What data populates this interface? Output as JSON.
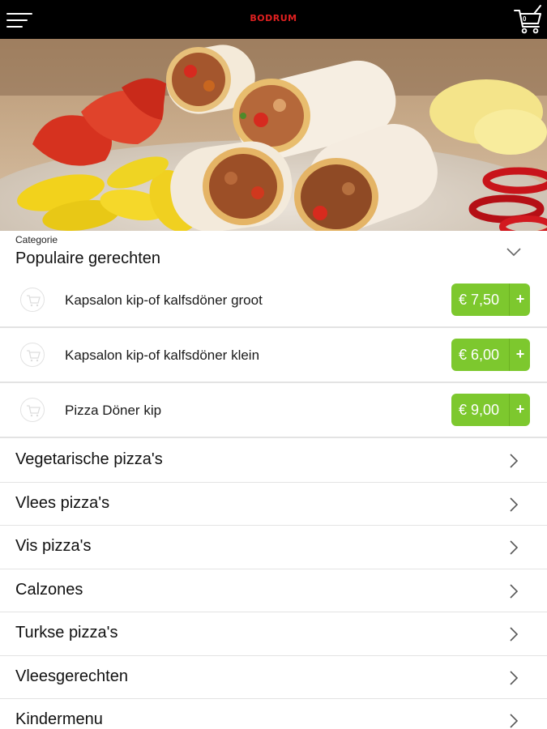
{
  "app": {
    "brand": "BODRUM",
    "cart_count": "0",
    "menu_icon": "hamburger-menu-icon",
    "cart_icon": "shopping-cart-icon"
  },
  "colors": {
    "topbar": "#000000",
    "brand": "#e02020",
    "price_button": "#7dc82e"
  },
  "category": {
    "caption": "Categorie",
    "selected": "Populaire gerechten",
    "icon": "chevron-down-icon"
  },
  "products": [
    {
      "name": "Kapsalon kip-of kalfsdöner groot",
      "price": "€ 7,50",
      "add": "+"
    },
    {
      "name": "Kapsalon kip-of kalfsdöner klein",
      "price": "€ 6,00",
      "add": "+"
    },
    {
      "name": "Pizza Döner kip",
      "price": "€ 9,00",
      "add": "+"
    }
  ],
  "categories": [
    {
      "label": "Vegetarische pizza's"
    },
    {
      "label": "Vlees pizza's"
    },
    {
      "label": "Vis pizza's"
    },
    {
      "label": "Calzones"
    },
    {
      "label": "Turkse pizza's"
    },
    {
      "label": "Vleesgerechten"
    },
    {
      "label": "Kindermenu"
    }
  ]
}
